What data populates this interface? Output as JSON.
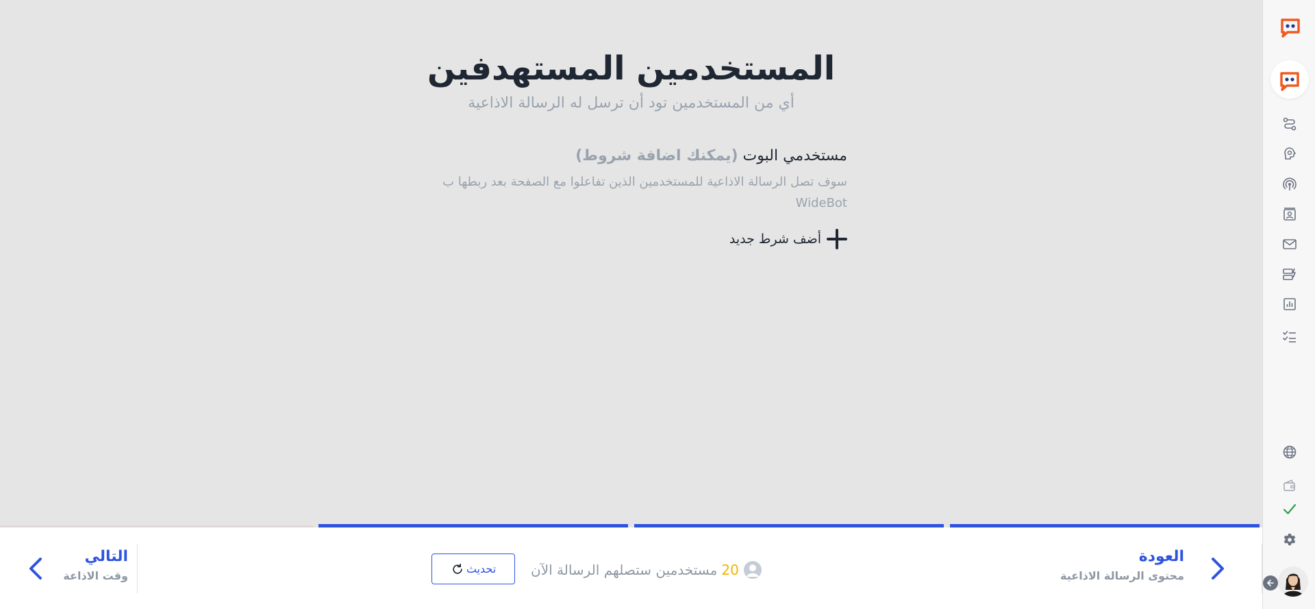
{
  "colors": {
    "accent": "#2e53e0",
    "title": "#1f2733",
    "muted": "#99a3ad",
    "count": "#f0b400",
    "brand": "#f05a22",
    "success": "#2e9e4f"
  },
  "page": {
    "title": "المستخدمين المستهدفين",
    "subtitle": "أي من المستخدمين تود أن ترسل له الرسالة الاذاعية"
  },
  "section": {
    "heading": "مستخدمي البوت",
    "heading_note": "(يمكنك اضافة شروط)",
    "description": "سوف تصل الرسالة الاذاعية للمستخدمين الذين تفاعلوا مع الصفحة بعد ربطها ب WideBot",
    "add_condition_label": "أضف شرط جديد"
  },
  "progress": {
    "steps_total": 4,
    "steps_done": 3
  },
  "footer": {
    "back": {
      "title": "العودة",
      "subtitle": "محتوى الرسالة الاذاعية"
    },
    "next": {
      "title": "التالي",
      "subtitle": "وقت الاذاعة"
    },
    "reach": {
      "count": "20",
      "text": "مستخدمين ستصلهم الرسالة الآن"
    },
    "refresh_label": "تحديث"
  },
  "sidebar": {
    "icons": [
      "widebot-logo",
      "bot-logo",
      "flow-icon",
      "brain-icon",
      "broadcast-icon",
      "contacts-icon",
      "mail-icon",
      "cards-icon",
      "analytics-icon",
      "checklist-icon",
      "globe-icon",
      "wallet-icon",
      "check-icon",
      "gear-icon"
    ]
  }
}
